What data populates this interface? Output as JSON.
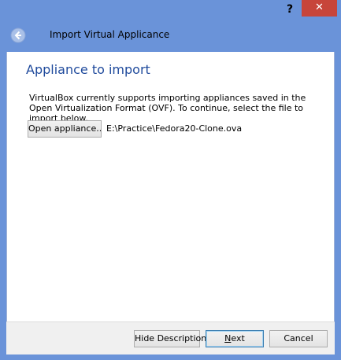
{
  "titlebar": {
    "help_label": "?",
    "close_label": "✕"
  },
  "header": {
    "title": "Import Virtual Applicance"
  },
  "page": {
    "heading": "Appliance to import",
    "description": "VirtualBox currently supports importing appliances saved in the Open Virtualization Format (OVF). To continue, select the file to import below.",
    "open_button_label": "Open appliance...",
    "file_path": "E:\\Practice\\Fedora20-Clone.ova"
  },
  "footer": {
    "hide_description_label": "Hide Description",
    "next_label_first": "N",
    "next_label_rest": "ext",
    "cancel_label": "Cancel"
  },
  "colors": {
    "frame": "#6a93d9",
    "close": "#c7453a",
    "heading": "#1f4a9c"
  },
  "icons": {
    "back": "back-arrow-icon"
  }
}
